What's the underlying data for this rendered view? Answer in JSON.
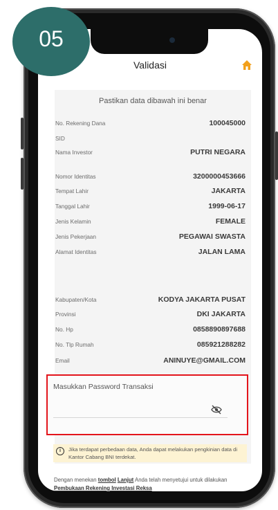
{
  "badge": {
    "number": "05"
  },
  "header": {
    "title": "Validasi",
    "home_icon": "home-icon",
    "accent": "#f2a01b"
  },
  "card": {
    "title": "Pastikan data dibawah ini benar",
    "rows": [
      {
        "label": "No. Rekening Dana",
        "value": "100045000"
      },
      {
        "label": "SID",
        "value": ""
      },
      {
        "label": "Nama Investor",
        "value": "PUTRI NEGARA"
      },
      {
        "label": "Nomor Identitas",
        "value": "3200000453666"
      },
      {
        "label": "Tempat Lahir",
        "value": "JAKARTA"
      },
      {
        "label": "Tanggal Lahir",
        "value": "1999-06-17"
      },
      {
        "label": "Jenis Kelamin",
        "value": "FEMALE"
      },
      {
        "label": "Jenis Pekerjaan",
        "value": "PEGAWAI SWASTA"
      },
      {
        "label": "Alamat Identitas",
        "value": "JALAN LAMA"
      },
      {
        "label": "Kabupaten/Kota",
        "value": "KODYA JAKARTA PUSAT"
      },
      {
        "label": "Provinsi",
        "value": "DKI JAKARTA"
      },
      {
        "label": "No. Hp",
        "value": "0858890897688"
      },
      {
        "label": "No. Tlp Rumah",
        "value": "085921288282"
      },
      {
        "label": "Email",
        "value": "ANINUYE@GMAIL.COM"
      }
    ]
  },
  "password": {
    "label": "Masukkan Password Transaksi",
    "value": "",
    "highlight_color": "#e3141b"
  },
  "notice": {
    "icon": "info-icon",
    "text": "Jika terdapat perbedaan data, Anda dapat melakukan pengkinian data di Kantor Cabang BNI terdekat."
  },
  "footer": {
    "prefix": "Dengan menekan ",
    "link_tombol": "tombol",
    "lanjut": "Lanjut",
    "middle": " Anda telah menyetujui untuk dilakukan ",
    "link2": "Pembukaan Rekening Investasi Reksa"
  }
}
